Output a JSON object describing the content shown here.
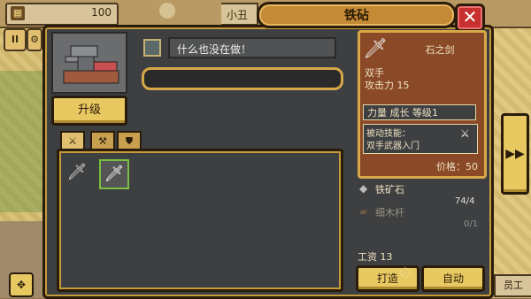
{
  "hud": {
    "gold": "100",
    "player_name": "小丑"
  },
  "dialog": {
    "title": "铁砧",
    "close": "✕"
  },
  "forge": {
    "upgrade_label": "升级",
    "status_text": "什么也没在做！",
    "progress": 0
  },
  "tabs": [
    {
      "name": "sword-tab",
      "glyph": "⚔"
    },
    {
      "name": "axe-tab",
      "glyph": "🪓"
    },
    {
      "name": "shield-tab",
      "glyph": "⛊"
    }
  ],
  "inventory": {
    "items": [
      {
        "name": "iron-sword-item",
        "glyph": "🗡",
        "selected": false
      },
      {
        "name": "stone-sword-item",
        "glyph": "🗡",
        "selected": true
      }
    ]
  },
  "item_card": {
    "name": "石之剑",
    "type": "双手",
    "attack": "攻击力 15",
    "attributes": "力量 成长 等级1",
    "skill_line1": "被动技能：",
    "skill_line2": "双手武器入门",
    "price": "价格：50"
  },
  "materials": [
    {
      "name": "铁矿石",
      "qty": "74/4",
      "icon": "◆",
      "available": true
    },
    {
      "name": "细木杆",
      "qty": "0/1",
      "icon": "▰",
      "available": false
    }
  ],
  "wage": "工资 13",
  "buttons": {
    "forge": "打造",
    "auto": "自动",
    "next": "▶▶",
    "staff": "员工"
  },
  "colors": {
    "panel": "#3d3f41",
    "accent_gold": "#d8a848",
    "card": "#8a4a28",
    "close_red": "#c83030"
  }
}
